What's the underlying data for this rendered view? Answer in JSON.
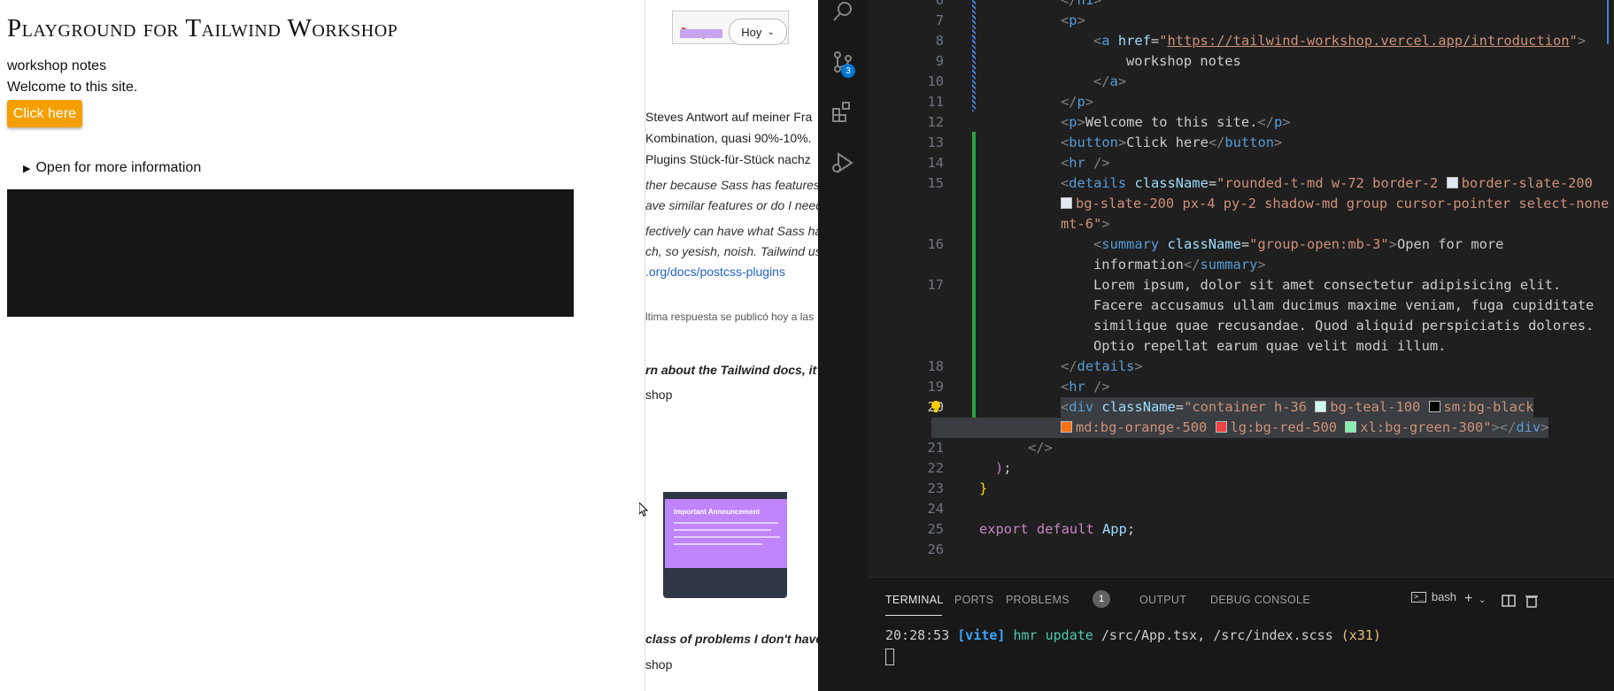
{
  "playground": {
    "title": "Playground for Tailwind Workshop",
    "link": "workshop notes",
    "welcome": "Welcome to this site.",
    "button": "Click here",
    "details_summary": "Open for more information"
  },
  "browser": {
    "hoy_label": "Hoy",
    "lines": [
      "Steves Antwort auf meiner Fra",
      "Kombination, quasi 90%-10%.",
      "Plugins Stück-für-Stück nachz",
      "ther because Sass has features s",
      "ave similar features or do I need",
      "fectively can have what Sass has",
      "ch, so yesish, noish. Tailwind use",
      ".org/docs/postcss-plugins",
      "ltima respuesta se publicó hoy a las",
      "rn about the Tailwind docs, it's",
      "shop",
      "class of problems I don't have to",
      "shop"
    ],
    "thumb_title": "Important Announcement"
  },
  "vscode": {
    "activity_badge": "3",
    "code_lines": [
      {
        "n": "6",
        "text": "</h1>"
      },
      {
        "n": "7",
        "text": "<p>"
      },
      {
        "n": "8",
        "text": "<a href=\"https://tailwind-workshop.vercel.app/introduction\">"
      },
      {
        "n": "9",
        "text": "workshop notes"
      },
      {
        "n": "10",
        "text": "</a>"
      },
      {
        "n": "11",
        "text": "</p>"
      },
      {
        "n": "12",
        "text": "<p>Welcome to this site.</p>"
      },
      {
        "n": "13",
        "text": "<button>Click here</button>"
      },
      {
        "n": "14",
        "text": "<hr />"
      },
      {
        "n": "15",
        "text": "<details className=\"rounded-t-md w-72 border-2 border-slate-200 bg-slate-200 px-4 py-2 shadow-md group cursor-pointer select-none mt-6\">"
      },
      {
        "n": "16",
        "text": "<summary className=\"group-open:mb-3\">Open for more information</summary>"
      },
      {
        "n": "17",
        "text": "Lorem ipsum, dolor sit amet consectetur adipisicing elit. Facere accusamus ullam ducimus maxime veniam, fuga cupiditate similique quae recusandae. Quod aliquid perspiciatis dolores. Optio repellat earum quae velit modi illum."
      },
      {
        "n": "18",
        "text": "</details>"
      },
      {
        "n": "19",
        "text": "<hr />"
      },
      {
        "n": "20",
        "text": "<div className=\"container h-36 bg-teal-100 sm:bg-black md:bg-orange-500 lg:bg-red-500 xl:bg-green-300\"></div>"
      },
      {
        "n": "21",
        "text": "</>"
      },
      {
        "n": "22",
        "text": ");"
      },
      {
        "n": "23",
        "text": "}"
      },
      {
        "n": "24",
        "text": ""
      },
      {
        "n": "25",
        "text": "export default App;"
      },
      {
        "n": "26",
        "text": ""
      }
    ],
    "panel": {
      "tabs": [
        "TERMINAL",
        "PORTS",
        "PROBLEMS",
        "OUTPUT",
        "DEBUG CONSOLE"
      ],
      "problems_count": "1",
      "shell": "bash",
      "terminal_time": "20:28:53",
      "terminal_tag": "[vite]",
      "terminal_hmr": "hmr update",
      "terminal_files": "/src/App.tsx, /src/index.scss",
      "terminal_count": "(x31)"
    },
    "colors": {
      "editor_bg": "#1f1f1f",
      "accent": "#0078d4",
      "git_added": "#2ea043"
    }
  }
}
